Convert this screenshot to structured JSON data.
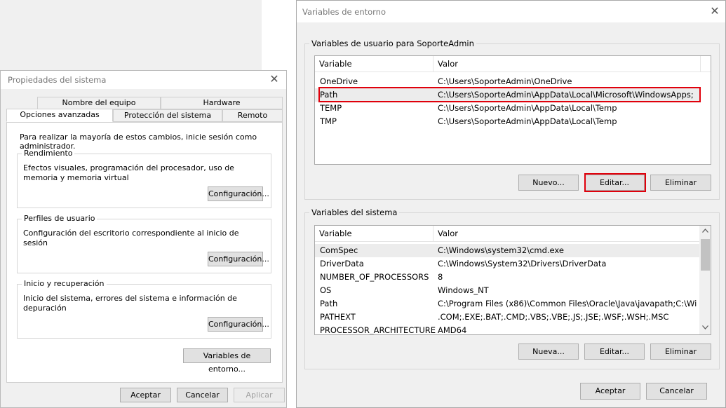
{
  "system_dialog": {
    "title": "Propiedades del sistema",
    "close": "✕",
    "tabs": [
      "Nombre del equipo",
      "Hardware",
      "Opciones avanzadas",
      "Protección del sistema",
      "Remoto"
    ],
    "intro": "Para realizar la mayoría de estos cambios, inicie sesión como administrador.",
    "performance": {
      "legend": "Rendimiento",
      "desc": "Efectos visuales, programación del procesador, uso de memoria y memoria virtual",
      "button": "Configuración..."
    },
    "profiles": {
      "legend": "Perfiles de usuario",
      "desc": "Configuración del escritorio correspondiente al inicio de sesión",
      "button": "Configuración..."
    },
    "startup": {
      "legend": "Inicio y recuperación",
      "desc": "Inicio del sistema, errores del sistema e información de depuración",
      "button": "Configuración..."
    },
    "env_button": "Variables de entorno...",
    "ok": "Aceptar",
    "cancel": "Cancelar",
    "apply": "Aplicar"
  },
  "env_dialog": {
    "title": "Variables de entorno",
    "close": "✕",
    "user_group": {
      "legend": "Variables de usuario para SoporteAdmin",
      "columns": [
        "Variable",
        "Valor"
      ],
      "rows": [
        {
          "var": "OneDrive",
          "val": "C:\\Users\\SoporteAdmin\\OneDrive"
        },
        {
          "var": "Path",
          "val": "C:\\Users\\SoporteAdmin\\AppData\\Local\\Microsoft\\WindowsApps;"
        },
        {
          "var": "TEMP",
          "val": "C:\\Users\\SoporteAdmin\\AppData\\Local\\Temp"
        },
        {
          "var": "TMP",
          "val": "C:\\Users\\SoporteAdmin\\AppData\\Local\\Temp"
        }
      ],
      "buttons": {
        "new": "Nuevo...",
        "edit": "Editar...",
        "delete": "Eliminar"
      }
    },
    "system_group": {
      "legend": "Variables del sistema",
      "columns": [
        "Variable",
        "Valor"
      ],
      "rows": [
        {
          "var": "ComSpec",
          "val": "C:\\Windows\\system32\\cmd.exe"
        },
        {
          "var": "DriverData",
          "val": "C:\\Windows\\System32\\Drivers\\DriverData"
        },
        {
          "var": "NUMBER_OF_PROCESSORS",
          "val": "8"
        },
        {
          "var": "OS",
          "val": "Windows_NT"
        },
        {
          "var": "Path",
          "val": "C:\\Program Files (x86)\\Common Files\\Oracle\\Java\\javapath;C:\\Win..."
        },
        {
          "var": "PATHEXT",
          "val": ".COM;.EXE;.BAT;.CMD;.VBS;.VBE;.JS;.JSE;.WSF;.WSH;.MSC"
        },
        {
          "var": "PROCESSOR_ARCHITECTURE",
          "val": "AMD64"
        }
      ],
      "buttons": {
        "new": "Nueva...",
        "edit": "Editar...",
        "delete": "Eliminar"
      }
    },
    "ok": "Aceptar",
    "cancel": "Cancelar"
  },
  "colors": {
    "highlight": "#e0000b",
    "selected_row": "#ececec"
  },
  "icons": {
    "close": "close-icon",
    "scroll_up": "chevron-up-icon",
    "scroll_down": "chevron-down-icon"
  }
}
